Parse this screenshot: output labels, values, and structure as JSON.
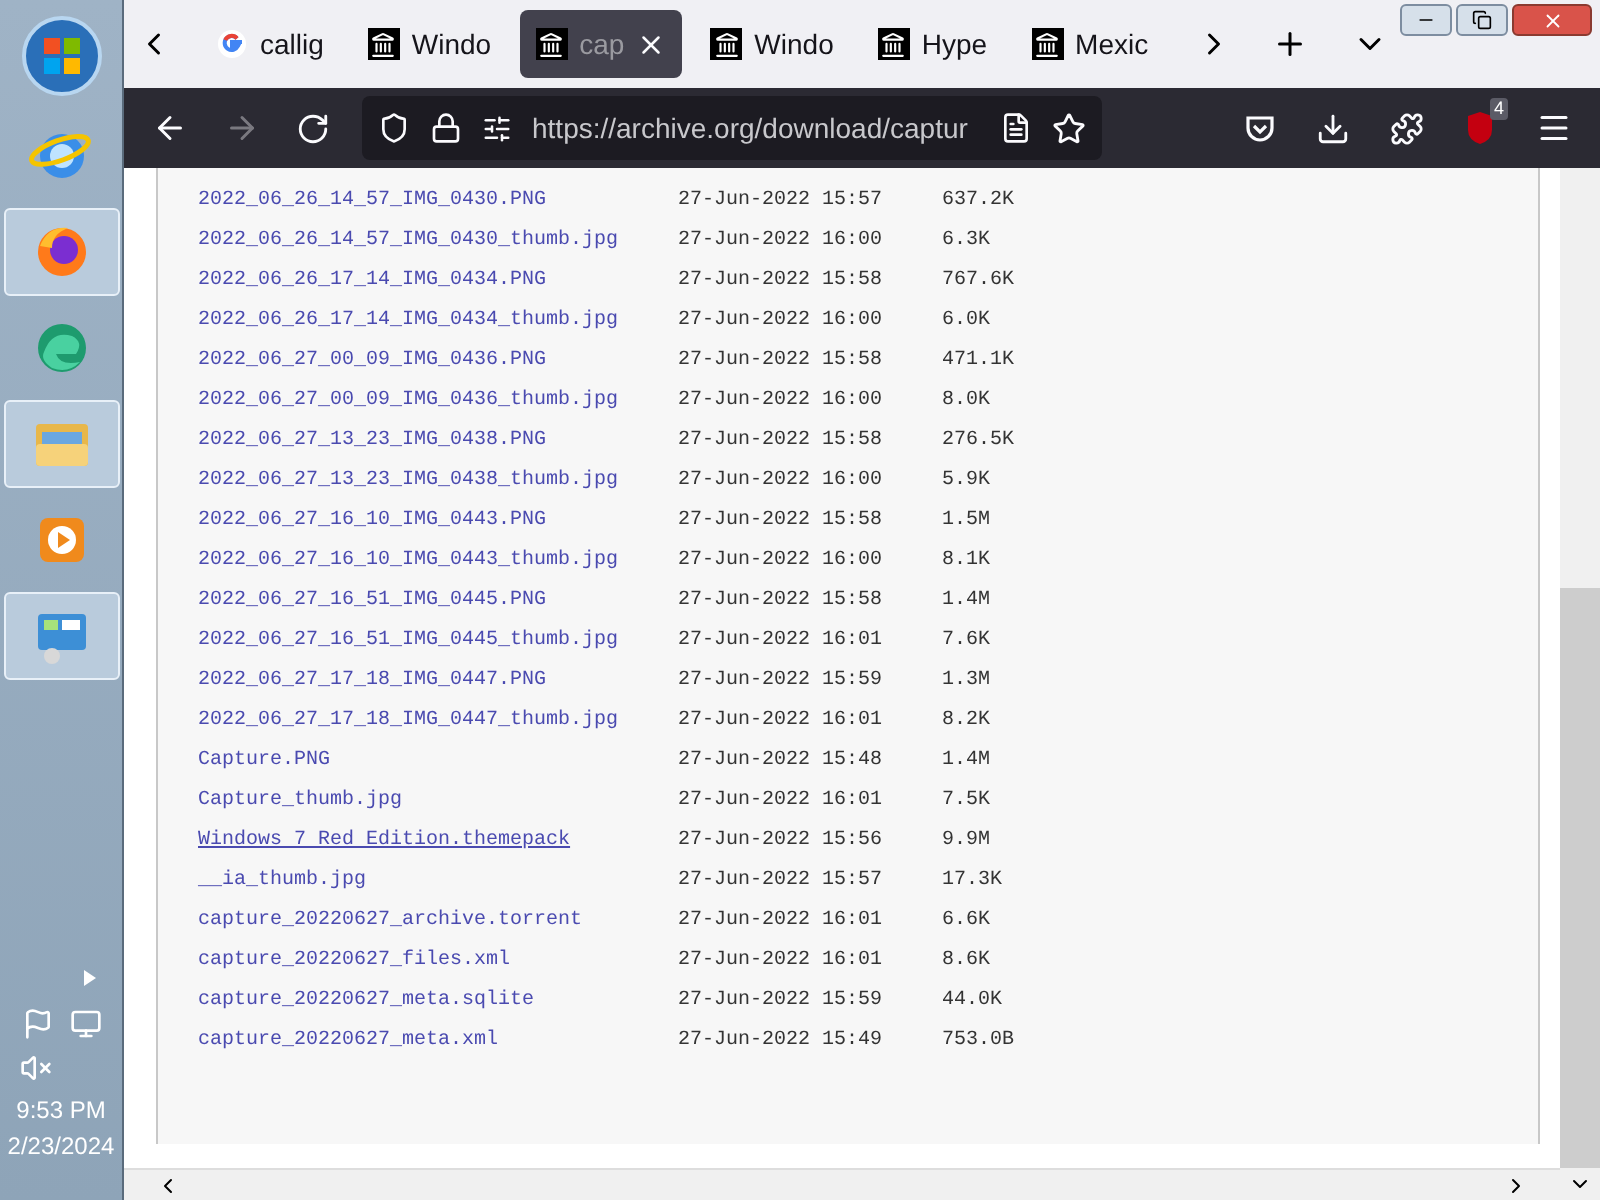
{
  "taskbar": {
    "apps": [
      {
        "kind": "ie",
        "highlighted": false
      },
      {
        "kind": "firefox",
        "highlighted": true
      },
      {
        "kind": "edge",
        "highlighted": false
      },
      {
        "kind": "explorer",
        "highlighted": true
      },
      {
        "kind": "media",
        "highlighted": false
      },
      {
        "kind": "panel",
        "highlighted": true
      }
    ],
    "time": "9:53 PM",
    "date": "2/23/2024"
  },
  "tabs": [
    {
      "kind": "google",
      "label": "callig",
      "selected": false
    },
    {
      "kind": "archive",
      "label": "Windo",
      "selected": false
    },
    {
      "kind": "archive",
      "label": "cap",
      "selected": true
    },
    {
      "kind": "archive",
      "label": "Windo",
      "selected": false
    },
    {
      "kind": "archive",
      "label": "Hype",
      "selected": false
    },
    {
      "kind": "archive",
      "label": "Mexic",
      "selected": false
    }
  ],
  "url": "https://archive.org/download/captur",
  "extension_badge": "4",
  "files": [
    {
      "name": "2022_06_26_14_57_IMG_0430.PNG",
      "date": "27-Jun-2022 15:57",
      "size": "637.2K",
      "underlined": false
    },
    {
      "name": "2022_06_26_14_57_IMG_0430_thumb.jpg",
      "date": "27-Jun-2022 16:00",
      "size": "6.3K",
      "underlined": false
    },
    {
      "name": "2022_06_26_17_14_IMG_0434.PNG",
      "date": "27-Jun-2022 15:58",
      "size": "767.6K",
      "underlined": false
    },
    {
      "name": "2022_06_26_17_14_IMG_0434_thumb.jpg",
      "date": "27-Jun-2022 16:00",
      "size": "6.0K",
      "underlined": false
    },
    {
      "name": "2022_06_27_00_09_IMG_0436.PNG",
      "date": "27-Jun-2022 15:58",
      "size": "471.1K",
      "underlined": false
    },
    {
      "name": "2022_06_27_00_09_IMG_0436_thumb.jpg",
      "date": "27-Jun-2022 16:00",
      "size": "8.0K",
      "underlined": false
    },
    {
      "name": "2022_06_27_13_23_IMG_0438.PNG",
      "date": "27-Jun-2022 15:58",
      "size": "276.5K",
      "underlined": false
    },
    {
      "name": "2022_06_27_13_23_IMG_0438_thumb.jpg",
      "date": "27-Jun-2022 16:00",
      "size": "5.9K",
      "underlined": false
    },
    {
      "name": "2022_06_27_16_10_IMG_0443.PNG",
      "date": "27-Jun-2022 15:58",
      "size": "1.5M",
      "underlined": false
    },
    {
      "name": "2022_06_27_16_10_IMG_0443_thumb.jpg",
      "date": "27-Jun-2022 16:00",
      "size": "8.1K",
      "underlined": false
    },
    {
      "name": "2022_06_27_16_51_IMG_0445.PNG",
      "date": "27-Jun-2022 15:58",
      "size": "1.4M",
      "underlined": false
    },
    {
      "name": "2022_06_27_16_51_IMG_0445_thumb.jpg",
      "date": "27-Jun-2022 16:01",
      "size": "7.6K",
      "underlined": false
    },
    {
      "name": "2022_06_27_17_18_IMG_0447.PNG",
      "date": "27-Jun-2022 15:59",
      "size": "1.3M",
      "underlined": false
    },
    {
      "name": "2022_06_27_17_18_IMG_0447_thumb.jpg",
      "date": "27-Jun-2022 16:01",
      "size": "8.2K",
      "underlined": false
    },
    {
      "name": "Capture.PNG",
      "date": "27-Jun-2022 15:48",
      "size": "1.4M",
      "underlined": false
    },
    {
      "name": "Capture_thumb.jpg",
      "date": "27-Jun-2022 16:01",
      "size": "7.5K",
      "underlined": false
    },
    {
      "name": "Windows 7 Red Edition.themepack",
      "date": "27-Jun-2022 15:56",
      "size": "9.9M",
      "underlined": true
    },
    {
      "name": "__ia_thumb.jpg",
      "date": "27-Jun-2022 15:57",
      "size": "17.3K",
      "underlined": false
    },
    {
      "name": "capture_20220627_archive.torrent",
      "date": "27-Jun-2022 16:01",
      "size": "6.6K",
      "underlined": false
    },
    {
      "name": "capture_20220627_files.xml",
      "date": "27-Jun-2022 16:01",
      "size": "8.6K",
      "underlined": false
    },
    {
      "name": "capture_20220627_meta.sqlite",
      "date": "27-Jun-2022 15:59",
      "size": "44.0K",
      "underlined": false
    },
    {
      "name": "capture_20220627_meta.xml",
      "date": "27-Jun-2022 15:49",
      "size": "753.0B",
      "underlined": false
    }
  ]
}
